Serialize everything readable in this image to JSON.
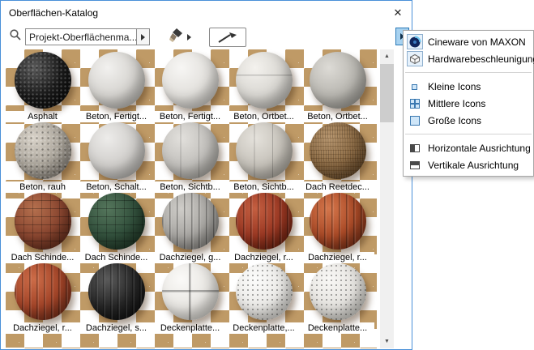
{
  "window": {
    "title": "Oberflächen-Katalog",
    "close_glyph": "✕"
  },
  "toolbar": {
    "catalog_value": "Projekt-Oberflächenma..."
  },
  "grid": {
    "pattern_color": "#bf9a66",
    "label_bg": "#ffffff"
  },
  "materials": [
    {
      "name": "Asphalt",
      "hl": "#585858",
      "base": "#1c1c1c",
      "dark": "#050505",
      "texture": "speckle"
    },
    {
      "name": "Beton, Fertigt...",
      "hl": "#f2f1ef",
      "base": "#d6d4d0",
      "dark": "#979590",
      "texture": "plain"
    },
    {
      "name": "Beton, Fertigt...",
      "hl": "#f7f6f4",
      "base": "#e2e0dc",
      "dark": "#a5a39e",
      "texture": "plain"
    },
    {
      "name": "Beton, Ortbet...",
      "hl": "#f4f2ee",
      "base": "#d9d7d2",
      "dark": "#9b9994",
      "texture": "hline"
    },
    {
      "name": "Beton, Ortbet...",
      "hl": "#dddbd6",
      "base": "#b9b7b1",
      "dark": "#807e78",
      "texture": "plain"
    },
    {
      "name": "Beton, rauh",
      "hl": "#d8d2c8",
      "base": "#aaa49a",
      "dark": "#6e6860",
      "texture": "speckle"
    },
    {
      "name": "Beton, Schalt...",
      "hl": "#edecea",
      "base": "#d0cecb",
      "dark": "#92908c",
      "texture": "plain"
    },
    {
      "name": "Beton, Sichtb...",
      "hl": "#e2e0dc",
      "base": "#c2c0bc",
      "dark": "#87857f",
      "texture": "vline"
    },
    {
      "name": "Beton, Sichtb...",
      "hl": "#e5e2dc",
      "base": "#c6c2ba",
      "dark": "#8a867e",
      "texture": "vline"
    },
    {
      "name": "Dach Reetdec...",
      "hl": "#bb9a72",
      "base": "#8d6c46",
      "dark": "#52391f",
      "texture": "thatch"
    },
    {
      "name": "Dach Schinde...",
      "hl": "#b5704e",
      "base": "#8a4630",
      "dark": "#4b2012",
      "texture": "shingle"
    },
    {
      "name": "Dach Schinde...",
      "hl": "#55765c",
      "base": "#32503c",
      "dark": "#152619",
      "texture": "shingle"
    },
    {
      "name": "Dachziegel, g...",
      "hl": "#cfcdc9",
      "base": "#a8a6a2",
      "dark": "#6d6b67",
      "texture": "ridged"
    },
    {
      "name": "Dachziegel, r...",
      "hl": "#c45f41",
      "base": "#993722",
      "dark": "#541708",
      "texture": "ridged"
    },
    {
      "name": "Dachziegel, r...",
      "hl": "#d4764b",
      "base": "#aa4a27",
      "dark": "#5f2310",
      "texture": "ridged"
    },
    {
      "name": "Dachziegel, r...",
      "hl": "#cc6c48",
      "base": "#a24428",
      "dark": "#5a2112",
      "texture": "ridged"
    },
    {
      "name": "Dachziegel, s...",
      "hl": "#5a5a5a",
      "base": "#262626",
      "dark": "#070707",
      "texture": "ridged"
    },
    {
      "name": "Deckenplatte...",
      "hl": "#fbfaf8",
      "base": "#e8e6e2",
      "dark": "#aeaca6",
      "texture": "cross"
    },
    {
      "name": "Deckenplatte,...",
      "hl": "#fcfcfb",
      "base": "#ebeae7",
      "dark": "#b2b0ab",
      "texture": "dots"
    },
    {
      "name": "Deckenplatte...",
      "hl": "#f9f8f6",
      "base": "#e5e3df",
      "dark": "#abaaa4",
      "texture": "dots"
    }
  ],
  "menu": {
    "items": [
      {
        "type": "item",
        "label": "Cineware von MAXON",
        "icon": "cineware-icon",
        "framed": true
      },
      {
        "type": "item",
        "label": "Hardwarebeschleunigung",
        "icon": "hardware-acceleration-icon",
        "framed": true
      },
      {
        "type": "separator"
      },
      {
        "type": "item",
        "label": "Kleine Icons",
        "icon": "small-icons-icon"
      },
      {
        "type": "item",
        "label": "Mittlere Icons",
        "icon": "medium-icons-icon"
      },
      {
        "type": "item",
        "label": "Große Icons",
        "icon": "large-icons-icon"
      },
      {
        "type": "separator"
      },
      {
        "type": "item",
        "label": "Horizontale Ausrichtung",
        "icon": "horizontal-alignment-icon"
      },
      {
        "type": "item",
        "label": "Vertikale Ausrichtung",
        "icon": "vertical-alignment-icon"
      }
    ]
  },
  "scrollbar": {
    "up_glyph": "▲",
    "down_glyph": "▼"
  }
}
